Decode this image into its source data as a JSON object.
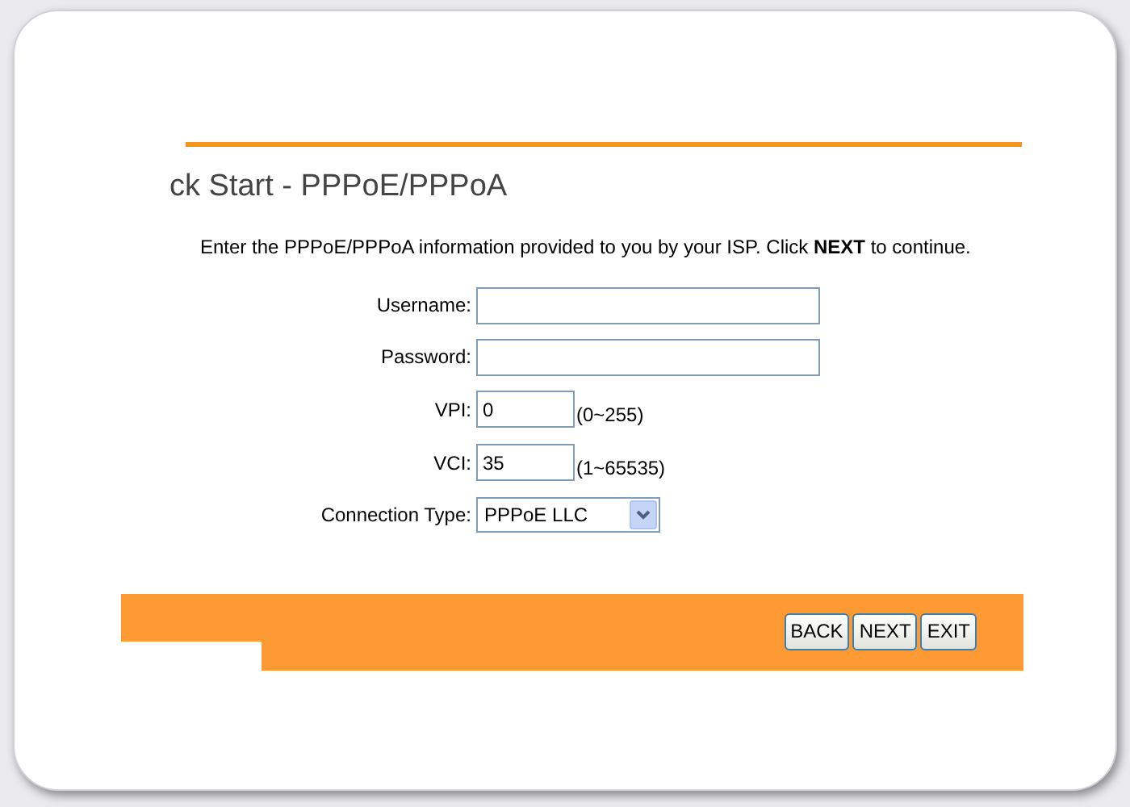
{
  "page": {
    "title": "ck Start - PPPoE/PPPoA",
    "instruction": "Enter the PPPoE/PPPoA information provided to you by your ISP. Click **NEXT** to continue."
  },
  "fields": [
    {
      "kind": "text",
      "label": "Username:"
    },
    {
      "kind": "text",
      "label": "Password:"
    },
    {
      "kind": "short",
      "label": "VPI:",
      "value": "0",
      "hint": "(0~255)"
    },
    {
      "kind": "short",
      "label": "VCI:",
      "value": "35",
      "hint": "(1~65535)"
    },
    {
      "kind": "select",
      "label": "Connection Type:",
      "value": "PPPoE LLC"
    }
  ],
  "buttons": [
    "BACK",
    "NEXT",
    "EXIT"
  ]
}
